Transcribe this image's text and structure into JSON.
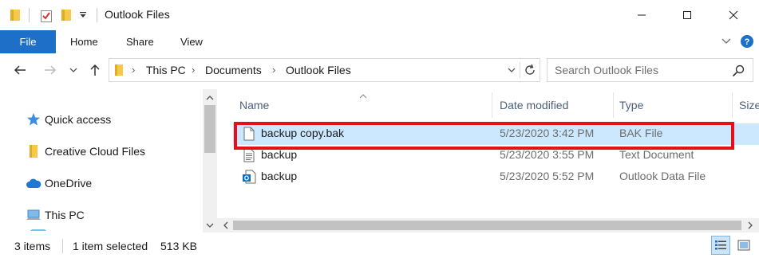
{
  "window": {
    "title": "Outlook Files",
    "controls": [
      "minimize",
      "maximize",
      "close"
    ]
  },
  "ribbon": {
    "tabs": [
      "File",
      "Home",
      "Share",
      "View"
    ],
    "active_tab": "File",
    "colors": {
      "file_tab_bg": "#1e6fc7"
    }
  },
  "address_bar": {
    "breadcrumbs": [
      "This PC",
      "Documents",
      "Outlook Files"
    ]
  },
  "search": {
    "placeholder": "Search Outlook Files"
  },
  "nav_pane": {
    "items": [
      {
        "label": "Quick access",
        "icon": "star-icon"
      },
      {
        "label": "Creative Cloud Files",
        "icon": "folder-icon"
      },
      {
        "label": "OneDrive",
        "icon": "cloud-icon"
      },
      {
        "label": "This PC",
        "icon": "computer-icon"
      }
    ]
  },
  "file_list": {
    "columns": [
      "Name",
      "Date modified",
      "Type",
      "Size"
    ],
    "rows": [
      {
        "name": "backup copy.bak",
        "date": "5/23/2020 3:42 PM",
        "type": "BAK File",
        "icon": "blank-file-icon",
        "selected": true
      },
      {
        "name": "backup",
        "date": "5/23/2020 3:55 PM",
        "type": "Text Document",
        "icon": "text-file-icon",
        "selected": false
      },
      {
        "name": "backup",
        "date": "5/23/2020 5:52 PM",
        "type": "Outlook Data File",
        "icon": "outlook-data-icon",
        "selected": false
      }
    ],
    "highlight_color": "#e5101c",
    "selected_bg": "#cce8ff"
  },
  "status_bar": {
    "item_count": "3 items",
    "selection": "1 item selected",
    "size": "513 KB"
  }
}
